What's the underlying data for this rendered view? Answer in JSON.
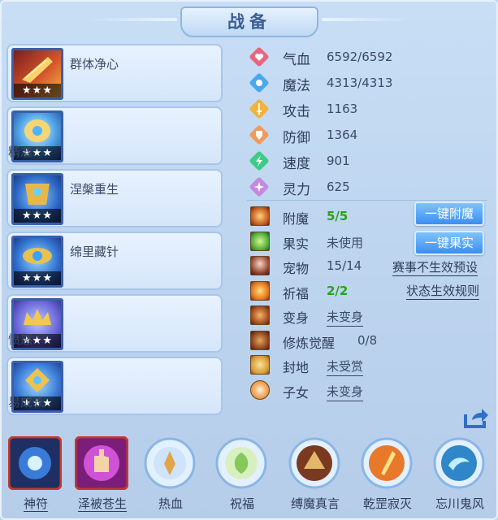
{
  "title": "战备",
  "skills": [
    {
      "name": "群体净心",
      "stars": "★★★"
    },
    {
      "name": "精准",
      "stars": "★★★"
    },
    {
      "name": "涅槃重生",
      "stars": "★★★"
    },
    {
      "name": "绵里藏针",
      "stars": "★★★"
    },
    {
      "name": "愤怒",
      "stars": "★★★"
    },
    {
      "name": "易成长",
      "stars": "★★★"
    }
  ],
  "stats": [
    {
      "label": "气血",
      "value": "6592/6592",
      "icon": "heart-icon",
      "color": "#e8657e"
    },
    {
      "label": "魔法",
      "value": "4313/4313",
      "icon": "mana-icon",
      "color": "#4aa8f0"
    },
    {
      "label": "攻击",
      "value": "1163",
      "icon": "sword-icon",
      "color": "#f2b33c"
    },
    {
      "label": "防御",
      "value": "1364",
      "icon": "shield-icon",
      "color": "#f19a5b"
    },
    {
      "label": "速度",
      "value": "901",
      "icon": "speed-icon",
      "color": "#3ccc86"
    },
    {
      "label": "灵力",
      "value": "625",
      "icon": "spirit-icon",
      "color": "#c58ae0"
    }
  ],
  "attrs": [
    {
      "label": "附魔",
      "value": "5/5",
      "icon": "enchant-icon"
    },
    {
      "label": "果实",
      "value": "未使用",
      "icon": "fruit-icon"
    },
    {
      "label": "宠物",
      "value": "15/14",
      "icon": "pet-icon"
    },
    {
      "label": "祈福",
      "value": "2/2",
      "icon": "blessing-icon"
    },
    {
      "label": "变身",
      "value": "未变身",
      "icon": "transform-icon"
    },
    {
      "label": "修炼觉醒",
      "value": "0/8",
      "icon": "cultivation-icon"
    },
    {
      "label": "封地",
      "value": "未受赏",
      "icon": "fief-icon"
    },
    {
      "label": "子女",
      "value": "未变身",
      "icon": "child-icon"
    }
  ],
  "buttons": {
    "enchant_all": "一键附魔",
    "fruit_all": "一键果实"
  },
  "links": {
    "event_preset": "赛事不生效预设",
    "status_rules": "状态生效规则"
  },
  "bottom": [
    {
      "name": "神符"
    },
    {
      "name": "泽被苍生"
    },
    {
      "name": "热血"
    },
    {
      "name": "祝福"
    },
    {
      "name": "缚魔真言"
    },
    {
      "name": "乾罡寂灭"
    },
    {
      "name": "忘川鬼风"
    }
  ],
  "colors": {
    "accent_button": "#3c8ef0",
    "value_green": "#22a51c",
    "panel_bg": "#c8def5"
  }
}
